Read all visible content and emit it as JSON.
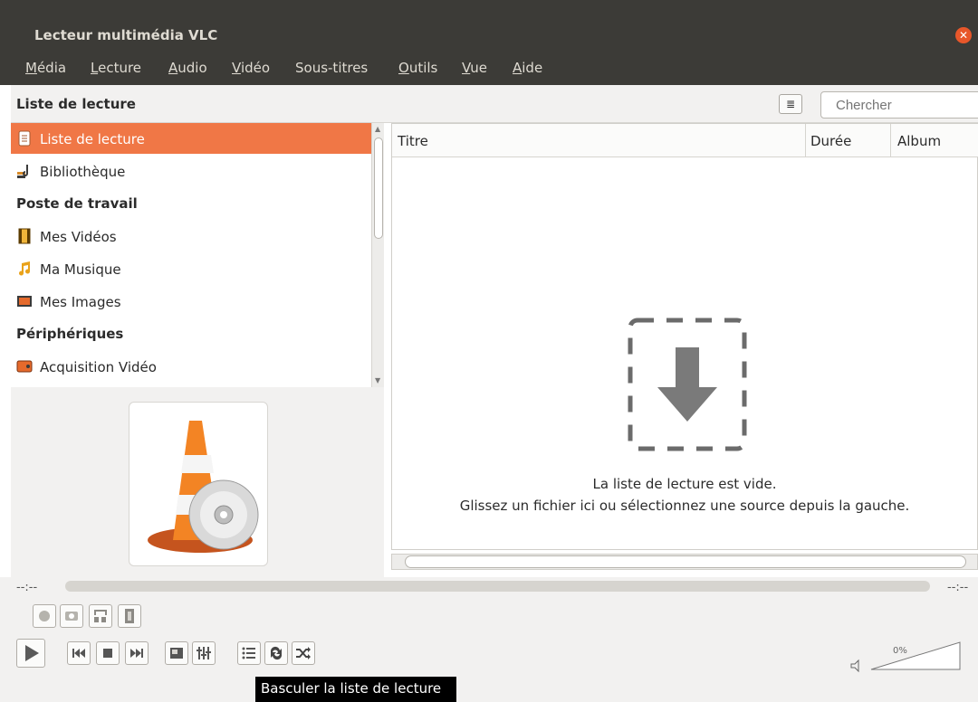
{
  "window": {
    "title": "Lecteur multimédia VLC"
  },
  "menu": {
    "items": [
      {
        "u": "M",
        "rest": "édia"
      },
      {
        "u": "L",
        "rest": "ecture"
      },
      {
        "u": "A",
        "rest": "udio"
      },
      {
        "u": "V",
        "rest": "idéo"
      },
      {
        "u": "",
        "rest": "Sous-titres"
      },
      {
        "u": "O",
        "rest": "utils"
      },
      {
        "u": "V",
        "rest": "ue"
      },
      {
        "u": "A",
        "rest": "ide"
      }
    ]
  },
  "playlist": {
    "header": "Liste de lecture",
    "search_placeholder": "Chercher",
    "sidebar": {
      "items": [
        {
          "label": "Liste de lecture",
          "icon": "playlist-icon",
          "selected": true
        },
        {
          "label": "Bibliothèque",
          "icon": "library-icon"
        },
        {
          "label": "Mes Vidéos",
          "icon": "video-film-icon"
        },
        {
          "label": "Ma Musique",
          "icon": "music-note-icon"
        },
        {
          "label": "Mes Images",
          "icon": "image-icon"
        },
        {
          "label": "Acquisition Vidéo",
          "icon": "capture-device-icon"
        }
      ],
      "categories": [
        "Poste de travail",
        "Périphériques"
      ]
    },
    "columns": [
      "Titre",
      "Durée",
      "Album"
    ],
    "empty_line1": "La liste de lecture est vide.",
    "empty_line2": "Glissez un fichier ici ou sélectionnez une source depuis la gauche."
  },
  "player": {
    "time_elapsed": "--:--",
    "time_total": "--:--",
    "volume_label": "0%",
    "tooltip": "Basculer la liste de lecture"
  },
  "colors": {
    "accent": "#f07746",
    "titlebar": "#3c3b37",
    "close": "#e8572a"
  }
}
